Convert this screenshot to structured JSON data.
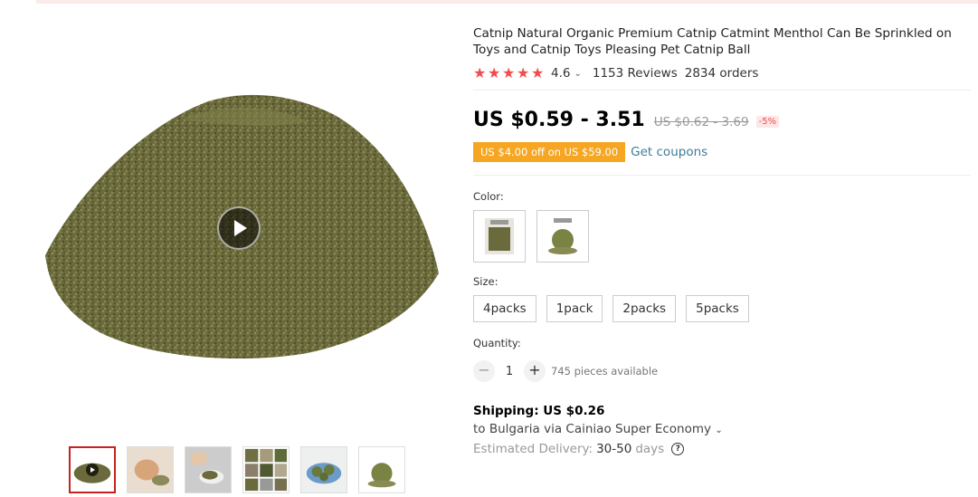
{
  "product": {
    "title": "Catnip Natural Organic Premium Catnip Catmint Menthol Can Be Sprinkled on Toys and Catnip Toys Pleasing Pet Catnip Ball",
    "rating": "4.6",
    "reviews": "1153 Reviews",
    "orders": "2834 orders",
    "price": "US $0.59 - 3.51",
    "old_price": "US $0.62 - 3.69",
    "discount": "-5%",
    "coupon": "US $4.00 off on US $59.00",
    "get_coupons": "Get coupons"
  },
  "options": {
    "color_label": "Color:",
    "size_label": "Size:",
    "sizes": [
      "4packs",
      "1pack",
      "2packs",
      "5packs"
    ],
    "quantity_label": "Quantity:",
    "quantity": "1",
    "minus": "−",
    "plus": "+",
    "available": "745 pieces available"
  },
  "shipping": {
    "title": "Shipping: US $0.26",
    "route": "to Bulgaria via Cainiao Super Economy",
    "delivery_label": "Estimated Delivery:",
    "delivery_days": "30-50",
    "delivery_unit": "days",
    "help": "?"
  },
  "gallery": {
    "thumbnails": [
      "catnip-pile",
      "cat-with-catnip",
      "hand-with-catnip",
      "catnip-collage",
      "catnip-balls-plate",
      "catnip-ball"
    ]
  },
  "colors": {
    "star": "#f44b4b",
    "coupon": "#f6a622",
    "link": "#3d7c96",
    "active_thumb": "#c8211f"
  }
}
